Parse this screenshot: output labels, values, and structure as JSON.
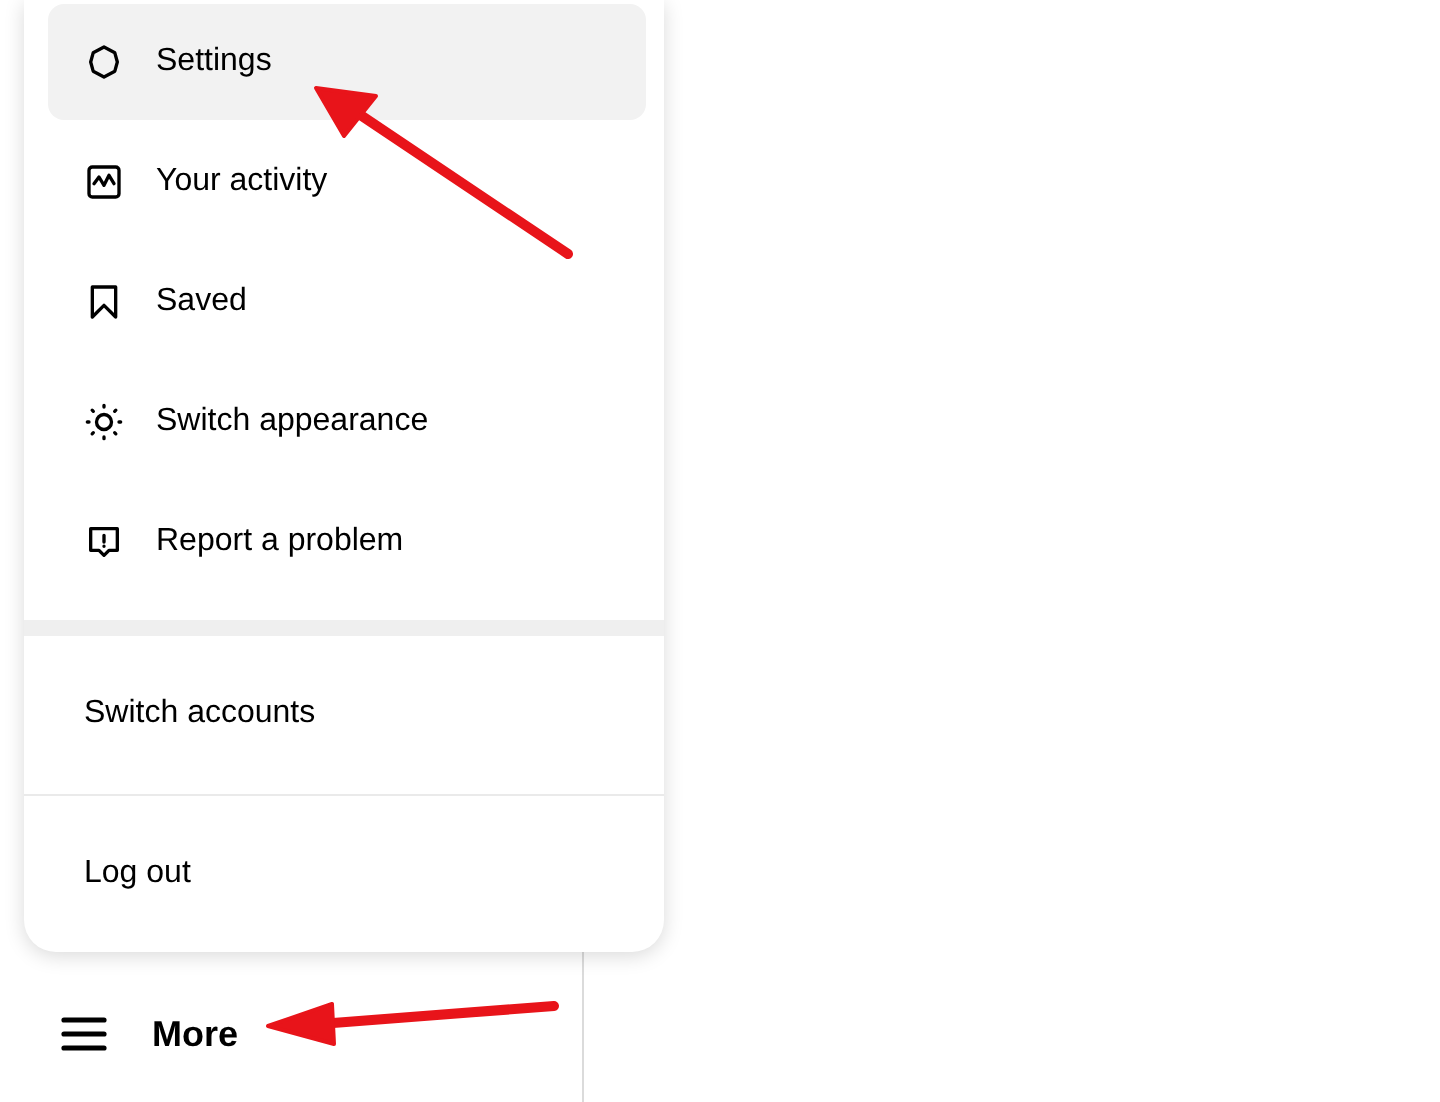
{
  "menu": {
    "items": [
      {
        "label": "Settings",
        "selected": true
      },
      {
        "label": "Your activity",
        "selected": false
      },
      {
        "label": "Saved",
        "selected": false
      },
      {
        "label": "Switch appearance",
        "selected": false
      },
      {
        "label": "Report a problem",
        "selected": false
      }
    ],
    "account_actions": [
      "Switch accounts",
      "Log out"
    ]
  },
  "sidebar": {
    "more_label": "More"
  }
}
